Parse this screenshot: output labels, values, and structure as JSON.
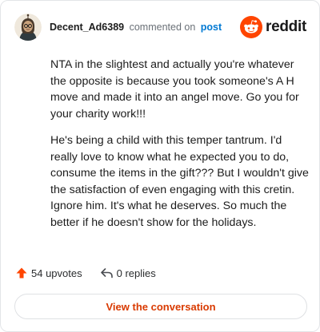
{
  "header": {
    "username": "Decent_Ad6389",
    "action_text": "commented on",
    "target_text": "post",
    "brand_name": "reddit",
    "brand_color": "#ff4500",
    "link_color": "#0079d3"
  },
  "comment": {
    "paragraphs": [
      "NTA in the slightest and actually you're whatever the opposite is because you took someone's A H move and made it into an angel move. Go you for your charity work!!!",
      "He's being a child with this temper tantrum. I'd really love to know what he expected you to do, consume the items in the gift??? But I wouldn't give the satisfaction of even engaging with this cretin. Ignore him. It's what he deserves. So much the better if he doesn't show for the holidays."
    ]
  },
  "stats": {
    "upvotes_text": "54 upvotes",
    "replies_text": "0 replies",
    "upvote_icon": "upvote-arrow-icon",
    "reply_icon": "reply-arrow-icon"
  },
  "cta": {
    "label": "View the conversation",
    "color": "#d93a00"
  }
}
